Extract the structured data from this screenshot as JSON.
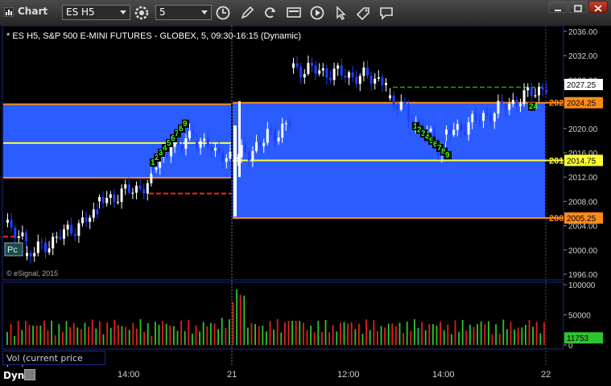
{
  "window": {
    "title": "Chart"
  },
  "toolbar": {
    "symbol": "ES H5",
    "interval": "5"
  },
  "chart_info": {
    "header": "* ES H5, S&P 500 E-MINI FUTURES - GLOBEX, 5, 09:30-16:15 (Dynamic)",
    "watermark": "© eSignal, 2015",
    "pc_badge": "Pc"
  },
  "price_axis": {
    "ticks": [
      "2036.00",
      "2032.00",
      "2028.00",
      "2024.00",
      "2020.00",
      "2016.00",
      "2012.00",
      "2008.00",
      "2004.00",
      "2000.00",
      "1996.00"
    ]
  },
  "price_tags": [
    {
      "label": "2027.25",
      "value": 2027.25,
      "color": "#ffffff"
    },
    {
      "label": "2024.25",
      "value": 2024.25,
      "color": "#ff8c1a"
    },
    {
      "label": "2014.75",
      "value": 2014.75,
      "color": "#ffff33"
    },
    {
      "label": "2005.25",
      "value": 2005.25,
      "color": "#ff8c1a"
    }
  ],
  "level_labels": [
    {
      "text": "202",
      "value": 2024.25,
      "color": "#ff8c1a"
    },
    {
      "text": "201",
      "value": 2014.75,
      "color": "#ffff33"
    },
    {
      "text": "200",
      "value": 2005.25,
      "color": "#ff8c1a"
    }
  ],
  "volume_axis": {
    "ticks": [
      "100000",
      "50000",
      "0"
    ],
    "last_tag": "11753"
  },
  "volume_panel": {
    "label": "Vol (current price bar)"
  },
  "time_axis": {
    "ticks": [
      "14:00",
      "21",
      "12:00",
      "14:00",
      "22"
    ]
  },
  "status": {
    "mode": "Dyn"
  },
  "sequence_markers": {
    "day1": [
      "1",
      "2",
      "3",
      "4",
      "5",
      "6",
      "7",
      "8",
      "9"
    ],
    "day2_top": [
      "24"
    ],
    "day2_mid": [
      "1",
      "2",
      "3",
      "4",
      "5",
      "6",
      "7",
      "8",
      "9"
    ]
  },
  "colors": {
    "accent_blue": "#2a5cff",
    "up": "#ffffff",
    "down": "#1f3fff",
    "orange": "#ff8c1a",
    "yellow": "#ffff33"
  }
}
